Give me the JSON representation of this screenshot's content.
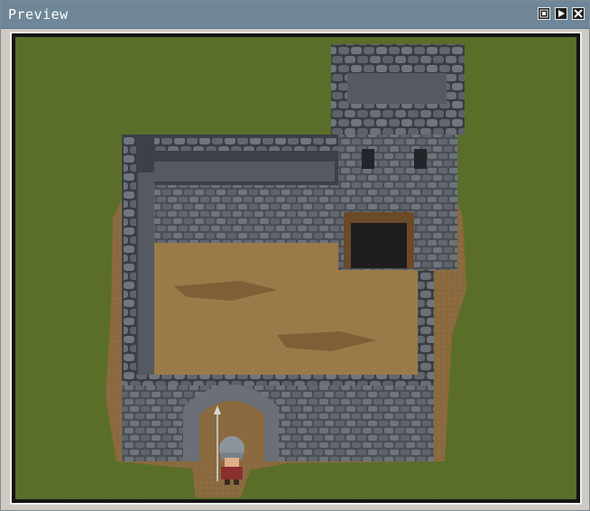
{
  "window": {
    "title": "Preview",
    "buttons": [
      "fullscreen-icon",
      "play-icon",
      "close-icon"
    ]
  },
  "scene": {
    "description_colors": {
      "grass": "#5a6e2a",
      "dirt": "#8a6a3e",
      "stone": "#5a5f66",
      "stone_light": "#7a8088",
      "stone_dark": "#2e3136"
    }
  }
}
